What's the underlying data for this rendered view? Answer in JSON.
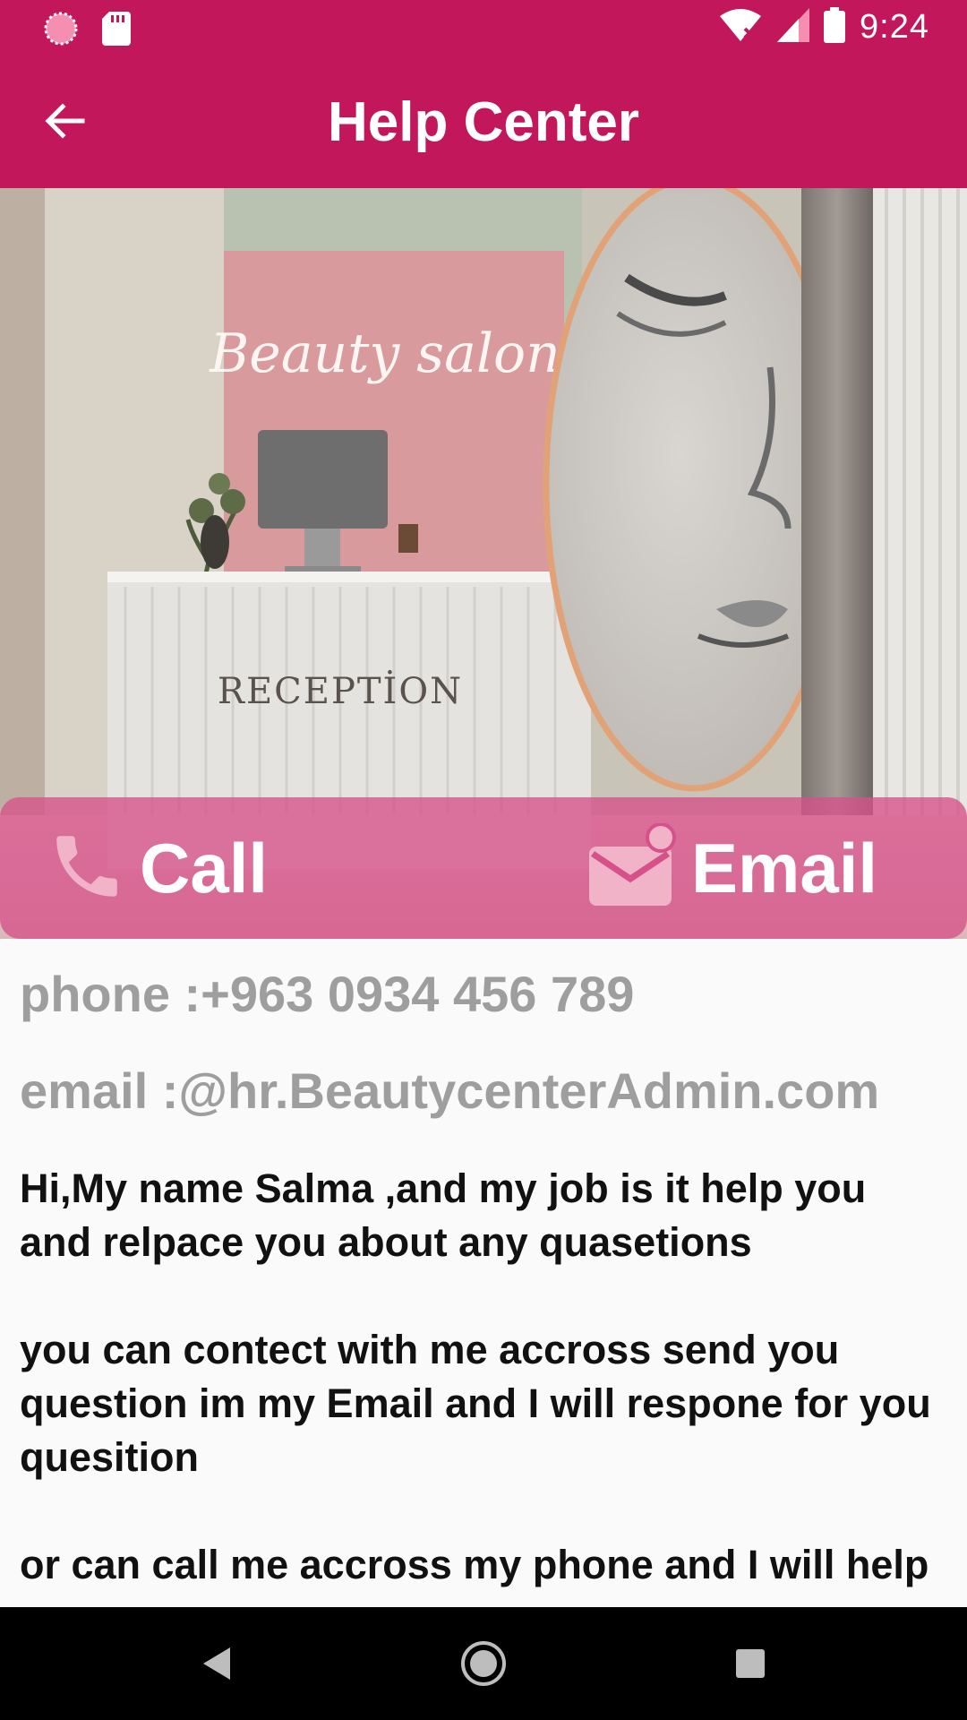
{
  "status_bar": {
    "time": "9:24",
    "icons": [
      "notification-dot-icon",
      "sd-card-icon",
      "wifi-off-icon",
      "signal-icon",
      "battery-icon"
    ]
  },
  "app_bar": {
    "title": "Help Center",
    "back_icon": "arrow-back-icon"
  },
  "hero": {
    "sign_text": "Beauty salon",
    "desk_text": "RECEPTİON"
  },
  "actions": {
    "call_label": "Call",
    "call_icon": "phone-icon",
    "email_label": "Email",
    "email_icon": "email-badge-icon"
  },
  "contact": {
    "phone": "phone :+963 0934 456 789",
    "email": "email :@hr.BeautycenterAdmin.com"
  },
  "about": {
    "text": "Hi,My name Salma ,and my job is it help you and relpace you about any quasetions\n\nyou can contect with me accross send you question im my Email and I will respone for you quesition\n\nor can call me accross my phone and I will help you"
  },
  "colors": {
    "primary": "#c2185b",
    "action_overlay": "#d65189",
    "info_text": "#9e9e9e"
  },
  "nav_bar": {
    "icons": [
      "back-triangle-icon",
      "home-circle-icon",
      "recents-square-icon"
    ]
  }
}
